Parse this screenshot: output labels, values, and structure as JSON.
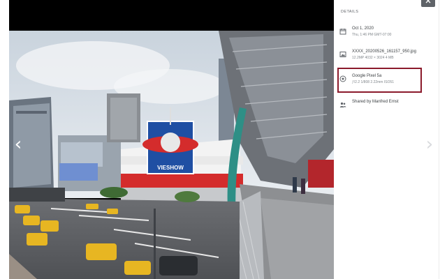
{
  "viewer": {
    "prev_glyph": "‹",
    "next_glyph": "›",
    "icons": {
      "prev": "chevron-left-icon",
      "next": "chevron-right-icon",
      "close": "close-icon"
    },
    "billboard_text": "VIESHOW"
  },
  "details": {
    "heading": "DETAILS",
    "date": {
      "icon": "calendar-icon",
      "line1": "Oct 1, 2020",
      "line2": "Thu, 1:46 PM   GMT-07:00"
    },
    "file": {
      "icon": "image-icon",
      "line1": "XXXX_20200526_161157_950.jpg",
      "line2": "12.2MP   4032 × 3024   4 MB"
    },
    "camera": {
      "icon": "aperture-icon",
      "line1": "Google Pixel 5a",
      "line2": "ƒ/2.2   1/808   2.22mm   ISO51"
    },
    "shared": {
      "icon": "people-icon",
      "line1": "Shared by Manfred Ernst"
    }
  },
  "colors": {
    "highlight": "#8b1a2b",
    "panel_text": "#3c4043",
    "secondary_text": "#80868b"
  }
}
